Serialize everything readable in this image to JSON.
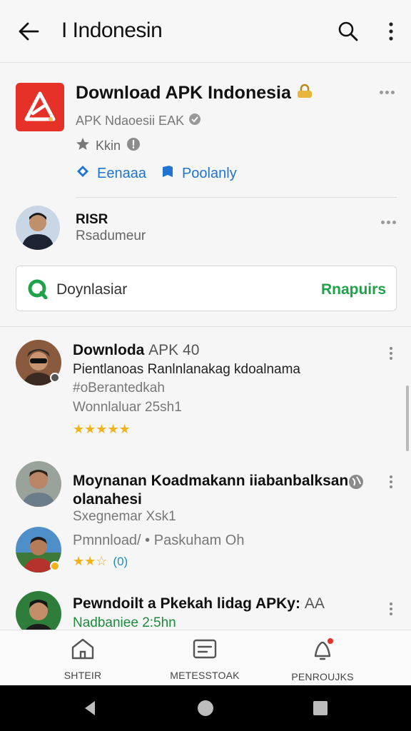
{
  "appbar": {
    "title": "I Indonesin"
  },
  "app": {
    "name": "Download APK Indonesia",
    "developer": "APK Ndaoesii EAK",
    "rating": "Kkin",
    "tags": [
      "Eenaaa",
      "Poolanly"
    ],
    "accent": "#e53127"
  },
  "publisher": {
    "name": "RISR",
    "subtitle": "Rsadumeur"
  },
  "install": {
    "label": "Doynlasiar",
    "action": "Rnapuirs"
  },
  "items": [
    {
      "title": "Downloda",
      "title_dim": "APK 40",
      "line1": "Pientlanoas Ranlnlanakag kdoalnama",
      "line2": "#oBerantedkah",
      "line3": "Wonnlaluar 25sh1",
      "stars": "★★★★★"
    },
    {
      "title": "Moynanan Koadmakann iiabanbalksan",
      "title2": "olanahesi",
      "line2": "Sxegnemar Xsk1"
    },
    {
      "line1": "Pmnnload/ • Paskuham Oh",
      "stars": "★★☆",
      "count": "(0)"
    },
    {
      "title": "Pewndoilt a Pkekah lidag APKy:",
      "title_dim": "AA",
      "line1": "Nadbaniee 2:5hn"
    }
  ],
  "bottom_nav": [
    {
      "label": "SHTEIR",
      "icon": "home-icon"
    },
    {
      "label": "METESSTOAK",
      "icon": "message-icon"
    },
    {
      "label": "PENROUJKS",
      "icon": "notifications-icon"
    }
  ]
}
